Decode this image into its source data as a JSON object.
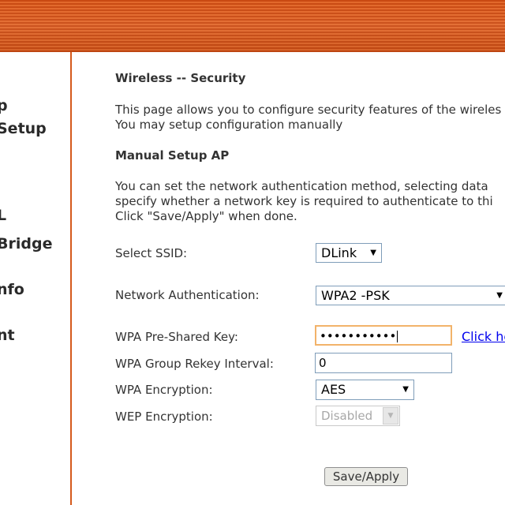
{
  "sidebar": {
    "items": [
      {
        "label": "p"
      },
      {
        "label": "Setup"
      },
      {
        "label": "L"
      },
      {
        "label": "Bridge"
      },
      {
        "label": "nfo"
      },
      {
        "label": "nt"
      }
    ]
  },
  "main": {
    "title": "Wireless -- Security",
    "intro_line1": "This page allows you to configure security features of the wireles",
    "intro_line2": "You may setup configuration manually",
    "section_title": "Manual Setup AP",
    "desc_line1": "You can set the network authentication method, selecting data",
    "desc_line2": "specify whether a network key is required to authenticate to thi",
    "desc_line3": "Click \"Save/Apply\" when done."
  },
  "form": {
    "ssid_label": "Select SSID:",
    "ssid_value": "DLink",
    "auth_label": "Network Authentication:",
    "auth_value": "WPA2 -PSK",
    "psk_label": "WPA Pre-Shared Key:",
    "psk_value": "•••••••••••",
    "psk_link": "Click he",
    "rekey_label": "WPA Group Rekey Interval:",
    "rekey_value": "0",
    "encryption_label": "WPA Encryption:",
    "encryption_value": "AES",
    "wep_label": "WEP Encryption:",
    "wep_value": "Disabled",
    "save_button": "Save/Apply"
  },
  "colors": {
    "topbar": "#e2672a",
    "sidebar_border": "#d55a1c",
    "link": "#0000ee",
    "focus_border": "#f2b36a"
  }
}
